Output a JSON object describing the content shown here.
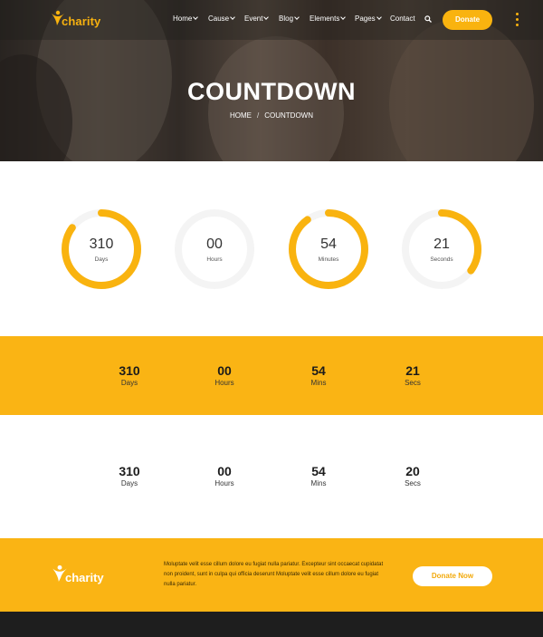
{
  "brand": {
    "name": "charity",
    "accent": "#f9b30f",
    "strip_color": "#fab414"
  },
  "nav": {
    "items": [
      {
        "label": "Home",
        "has_dropdown": true
      },
      {
        "label": "Cause",
        "has_dropdown": true
      },
      {
        "label": "Event",
        "has_dropdown": true
      },
      {
        "label": "Blog",
        "has_dropdown": true
      },
      {
        "label": "Elements",
        "has_dropdown": true
      },
      {
        "label": "Pages",
        "has_dropdown": true
      },
      {
        "label": "Contact",
        "has_dropdown": false
      }
    ],
    "search_icon": "search-icon",
    "donate_label": "Donate",
    "menu_icon": "vertical-dots-icon"
  },
  "hero": {
    "title": "COUNTDOWN",
    "breadcrumb": {
      "home": "HOME",
      "separator": "/",
      "current": "COUNTDOWN"
    }
  },
  "ring_countdown": [
    {
      "value": "310",
      "label": "Days",
      "progress": 0.85
    },
    {
      "value": "00",
      "label": "Hours",
      "progress": 0.0
    },
    {
      "value": "54",
      "label": "Minutes",
      "progress": 0.9
    },
    {
      "value": "21",
      "label": "Seconds",
      "progress": 0.35
    }
  ],
  "strip_countdown": [
    {
      "value": "310",
      "label": "Days"
    },
    {
      "value": "00",
      "label": "Hours"
    },
    {
      "value": "54",
      "label": "Mins"
    },
    {
      "value": "21",
      "label": "Secs"
    }
  ],
  "plain_countdown": [
    {
      "value": "310",
      "label": "Days"
    },
    {
      "value": "00",
      "label": "Hours"
    },
    {
      "value": "54",
      "label": "Mins"
    },
    {
      "value": "20",
      "label": "Secs"
    }
  ],
  "cta": {
    "logo_text": "charity",
    "text": "Moluptate velit esse cillum dolore eu fugiat nulla pariatur. Excepteur sint occaecat cupidatat non proident, sunt in culpa qui officia deserunt Moluptate velit esse cillum dolore eu fugiat nulla pariatur.",
    "button_label": "Donate Now"
  }
}
